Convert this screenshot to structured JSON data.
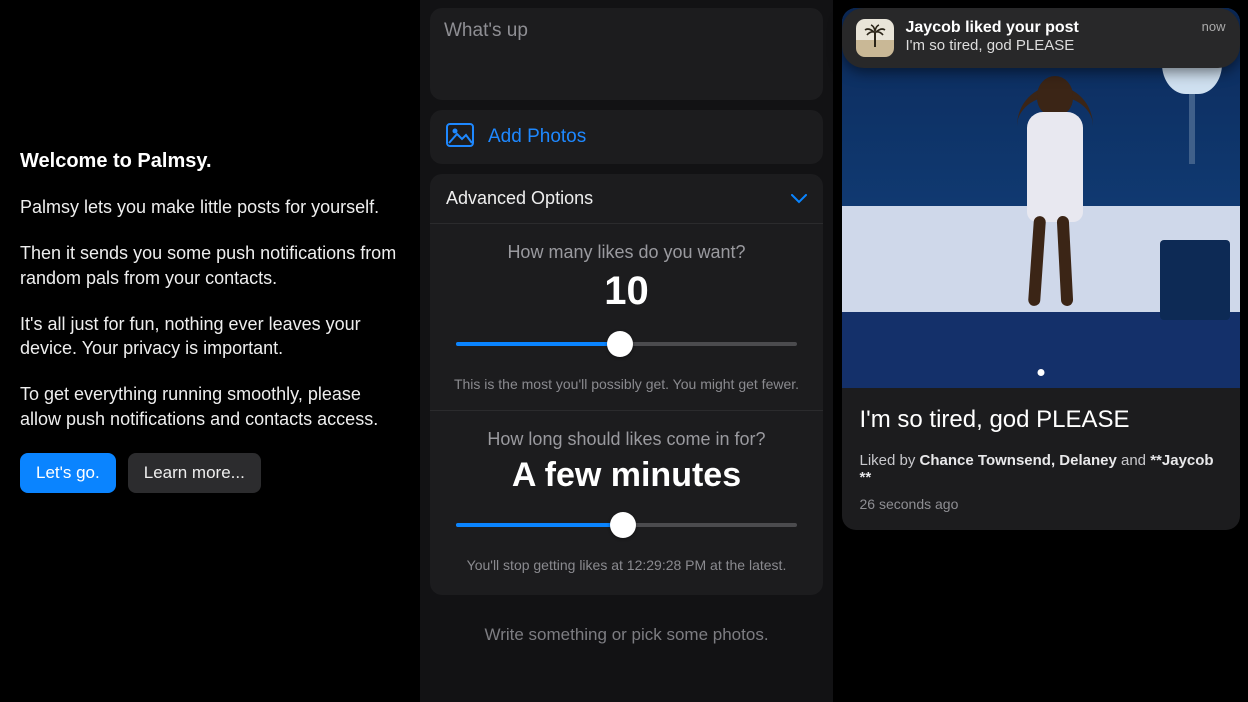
{
  "welcome": {
    "title": "Welcome to Palmsy.",
    "p1": "Palmsy lets you make little posts for yourself.",
    "p2": "Then it sends you some push notifications from random pals from your contacts.",
    "p3": "It's all just for fun, nothing ever leaves your device. Your privacy is important.",
    "p4": "To get everything running smoothly, please allow push notifications and contacts access.",
    "letsgo": "Let's go.",
    "learnmore": "Learn more..."
  },
  "compose": {
    "placeholder": "What's up",
    "add_photos": "Add Photos",
    "advanced_title": "Advanced Options",
    "likes_question": "How many likes do you want?",
    "likes_value": "10",
    "likes_slider_percent": 48,
    "likes_hint": "This is the most you'll possibly get. You might get fewer.",
    "duration_question": "How long should likes come in for?",
    "duration_value": "A few minutes",
    "duration_slider_percent": 49,
    "duration_hint": "You'll stop getting likes at 12:29:28 PM at the latest.",
    "footer": "Write something or pick some photos."
  },
  "notification": {
    "title": "Jaycob  liked your post",
    "subtitle": "I'm so tired, god PLEASE",
    "time": "now"
  },
  "post": {
    "text": "I'm so tired, god PLEASE",
    "liked_prefix": "Liked by ",
    "liked_names": "Chance  Townsend, Delaney",
    "liked_and": " and ",
    "liked_last": "**Jaycob **",
    "timestamp": "26 seconds ago"
  },
  "icons": {
    "photo": "photo-icon",
    "chevron_down": "chevron-down-icon",
    "palm": "palm-tree-icon"
  }
}
